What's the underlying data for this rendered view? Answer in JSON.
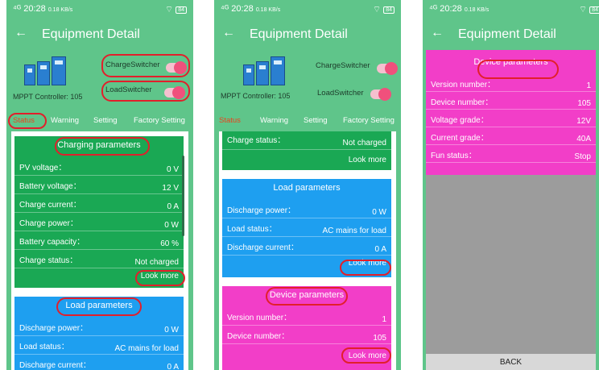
{
  "status_bar": {
    "signal": "⁴ᴳ",
    "time": "20:28",
    "net": "0.18 KB/s",
    "wifi": "wifi-icon",
    "battery": "84"
  },
  "app": {
    "title": "Equipment Detail",
    "back_icon": "arrow-left-icon"
  },
  "header": {
    "controller_label": "MPPT Controller:",
    "controller_id": "105",
    "charge_switch_label": "ChargeSwitcher",
    "load_switch_label": "LoadSwitcher",
    "charge_switch_on": true,
    "load_switch_on": true
  },
  "tabs": [
    {
      "label": "Status",
      "active": true
    },
    {
      "label": "Warning",
      "active": false
    },
    {
      "label": "Setting",
      "active": false
    },
    {
      "label": "Factory Setting",
      "active": false
    }
  ],
  "charging": {
    "title": "Charging parameters",
    "rows": [
      {
        "k": "PV voltage：",
        "v": "0 V"
      },
      {
        "k": "Battery voltage：",
        "v": "12 V"
      },
      {
        "k": "Charge current：",
        "v": "0 A"
      },
      {
        "k": "Charge power：",
        "v": "0 W"
      },
      {
        "k": "Battery capacity：",
        "v": "60 %"
      },
      {
        "k": "Charge status：",
        "v": "Not charged"
      }
    ],
    "look_more": "Look more"
  },
  "load": {
    "title": "Load parameters",
    "rows": [
      {
        "k": "Discharge power：",
        "v": "0 W"
      },
      {
        "k": "Load status：",
        "v": "AC mains for load"
      },
      {
        "k": "Discharge current：",
        "v": "0 A"
      }
    ],
    "look_more": "Look more"
  },
  "device": {
    "title": "Device parameters",
    "rows": [
      {
        "k": "Version number：",
        "v": "1"
      },
      {
        "k": "Device number：",
        "v": "105"
      }
    ],
    "look_more": "Look more"
  },
  "device_full": {
    "title": "Device parameters",
    "rows": [
      {
        "k": "Version number：",
        "v": "1"
      },
      {
        "k": "Device number：",
        "v": "105"
      },
      {
        "k": "Voltage grade：",
        "v": "12V"
      },
      {
        "k": "Current grade：",
        "v": "40A"
      },
      {
        "k": "Fun status：",
        "v": "Stop"
      }
    ],
    "back_label": "BACK"
  },
  "colors": {
    "app_green": "#5fc58a",
    "charging_card": "#1aa854",
    "load_card": "#1e9ff0",
    "device_card": "#f23ec8",
    "highlight": "#e21f2b",
    "active_tab": "#e9431e"
  }
}
